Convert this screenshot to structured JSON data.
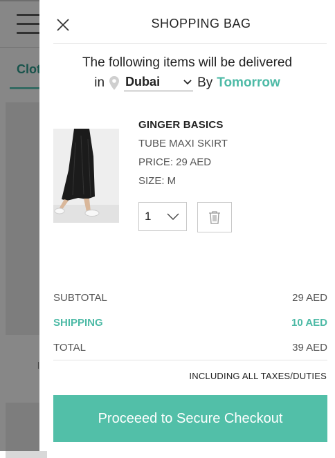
{
  "background": {
    "tab_label": "Clot",
    "stub_text": "l"
  },
  "bag": {
    "title": "SHOPPING BAG",
    "delivery_line1": "The following items will be delivered",
    "in_label": "in",
    "city": "Dubai",
    "by_label": "By",
    "when": "Tomorrow"
  },
  "item": {
    "brand": "GINGER BASICS",
    "name": "TUBE MAXI SKIRT",
    "price": "PRICE: 29 AED",
    "size": "SIZE: M",
    "quantity": "1"
  },
  "totals": {
    "subtotal_label": "SUBTOTAL",
    "subtotal_value": "29 AED",
    "shipping_label": "SHIPPING",
    "shipping_value": "10 AED",
    "total_label": "TOTAL",
    "total_value": "39 AED",
    "taxes_note": "INCLUDING ALL TAXES/DUTIES"
  },
  "checkout_label": "Proceeed to Secure Checkout",
  "icons": {
    "close": "close-icon",
    "pin": "location-pin-icon",
    "chevron": "chevron-down-icon",
    "trash": "trash-icon"
  },
  "colors": {
    "accent": "#52bfa8",
    "accent_text": "#4dbaa6"
  }
}
